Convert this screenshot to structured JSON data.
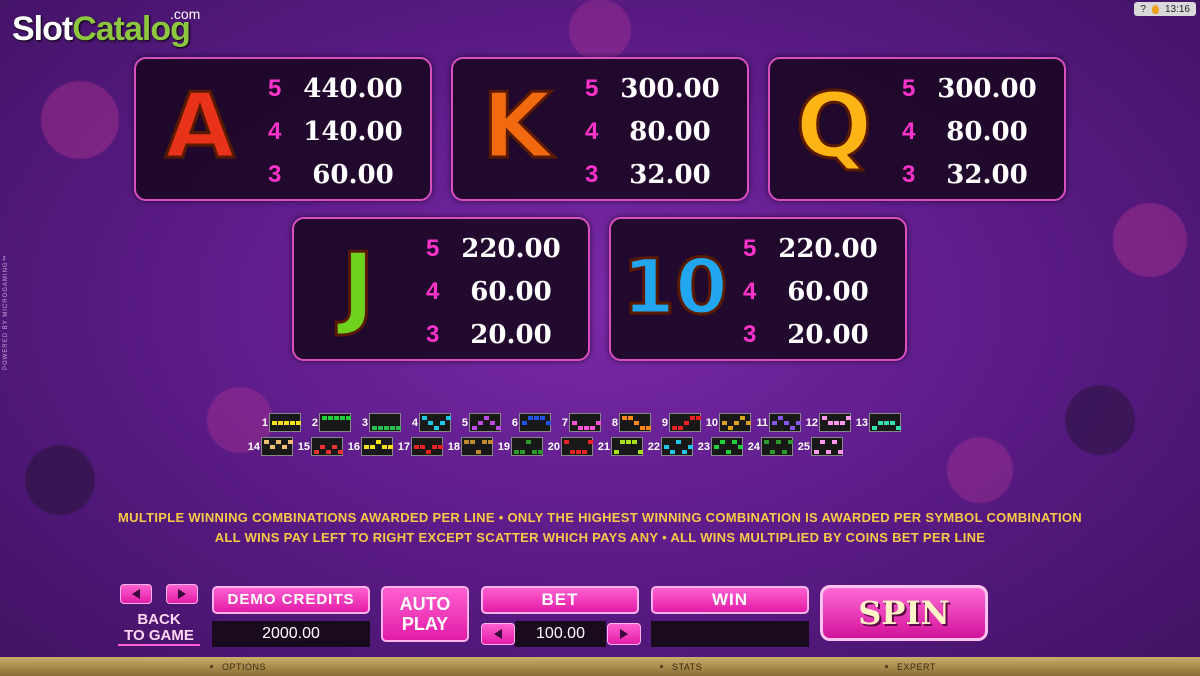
{
  "brand": {
    "slot": "Slot",
    "catalog": "Catalog",
    "com": ".com"
  },
  "system": {
    "help": "?",
    "time": "13:16"
  },
  "powered_by": "POWERED BY MICROGAMING™",
  "paytable": [
    {
      "symbol": "A",
      "color": "#e8321a",
      "pays": [
        {
          "count": "5",
          "value": "440.00"
        },
        {
          "count": "4",
          "value": "140.00"
        },
        {
          "count": "3",
          "value": "60.00"
        }
      ]
    },
    {
      "symbol": "K",
      "color": "#f26a10",
      "pays": [
        {
          "count": "5",
          "value": "300.00"
        },
        {
          "count": "4",
          "value": "80.00"
        },
        {
          "count": "3",
          "value": "32.00"
        }
      ]
    },
    {
      "symbol": "Q",
      "color": "#fdb515",
      "pays": [
        {
          "count": "5",
          "value": "300.00"
        },
        {
          "count": "4",
          "value": "80.00"
        },
        {
          "count": "3",
          "value": "32.00"
        }
      ]
    },
    {
      "symbol": "J",
      "color": "#6fd21e",
      "pays": [
        {
          "count": "5",
          "value": "220.00"
        },
        {
          "count": "4",
          "value": "60.00"
        },
        {
          "count": "3",
          "value": "20.00"
        }
      ]
    },
    {
      "symbol": "10",
      "color": "#22a6ef",
      "pays": [
        {
          "count": "5",
          "value": "220.00"
        },
        {
          "count": "4",
          "value": "60.00"
        },
        {
          "count": "3",
          "value": "20.00"
        }
      ]
    }
  ],
  "paylines": [
    {
      "n": "1",
      "color": "#f5e11a",
      "rows": [
        1,
        1,
        1,
        1,
        1
      ]
    },
    {
      "n": "2",
      "color": "#1fd13a",
      "rows": [
        0,
        0,
        0,
        0,
        0
      ]
    },
    {
      "n": "3",
      "color": "#29c04a",
      "rows": [
        2,
        2,
        2,
        2,
        2
      ]
    },
    {
      "n": "4",
      "color": "#1fc7e8",
      "rows": [
        0,
        1,
        2,
        1,
        0
      ]
    },
    {
      "n": "5",
      "color": "#c04ae8",
      "rows": [
        2,
        1,
        0,
        1,
        2
      ]
    },
    {
      "n": "6",
      "color": "#2255ee",
      "rows": [
        1,
        0,
        0,
        0,
        1
      ]
    },
    {
      "n": "7",
      "color": "#ff55dd",
      "rows": [
        1,
        2,
        2,
        2,
        1
      ]
    },
    {
      "n": "8",
      "color": "#ff8a1a",
      "rows": [
        0,
        0,
        1,
        2,
        2
      ]
    },
    {
      "n": "9",
      "color": "#ee2222",
      "rows": [
        2,
        2,
        1,
        0,
        0
      ]
    },
    {
      "n": "10",
      "color": "#d9a41a",
      "rows": [
        1,
        2,
        1,
        0,
        1
      ]
    },
    {
      "n": "11",
      "color": "#8a55ee",
      "rows": [
        1,
        0,
        1,
        2,
        1
      ]
    },
    {
      "n": "12",
      "color": "#ff99ee",
      "rows": [
        0,
        1,
        1,
        1,
        0
      ]
    },
    {
      "n": "13",
      "color": "#33e0b0",
      "rows": [
        2,
        1,
        1,
        1,
        2
      ]
    },
    {
      "n": "14",
      "color": "#f0c070",
      "rows": [
        0,
        1,
        0,
        1,
        0
      ]
    },
    {
      "n": "15",
      "color": "#ee3333",
      "rows": [
        2,
        1,
        2,
        1,
        2
      ]
    },
    {
      "n": "16",
      "color": "#f5e11a",
      "rows": [
        1,
        1,
        0,
        1,
        1
      ]
    },
    {
      "n": "17",
      "color": "#ee2222",
      "rows": [
        1,
        1,
        2,
        1,
        1
      ]
    },
    {
      "n": "18",
      "color": "#c08a30",
      "rows": [
        0,
        0,
        2,
        0,
        0
      ]
    },
    {
      "n": "19",
      "color": "#2a9a2a",
      "rows": [
        2,
        2,
        0,
        2,
        2
      ]
    },
    {
      "n": "20",
      "color": "#ee2222",
      "rows": [
        0,
        2,
        2,
        2,
        0
      ]
    },
    {
      "n": "21",
      "color": "#a8e01a",
      "rows": [
        2,
        0,
        0,
        0,
        2
      ]
    },
    {
      "n": "22",
      "color": "#1fc7e8",
      "rows": [
        1,
        2,
        0,
        2,
        1
      ]
    },
    {
      "n": "23",
      "color": "#1fd13a",
      "rows": [
        1,
        0,
        2,
        0,
        1
      ]
    },
    {
      "n": "24",
      "color": "#2a9a2a",
      "rows": [
        0,
        2,
        0,
        2,
        0
      ]
    },
    {
      "n": "25",
      "color": "#ff99ee",
      "rows": [
        2,
        0,
        2,
        0,
        2
      ]
    }
  ],
  "rules": {
    "line1": "MULTIPLE WINNING COMBINATIONS AWARDED PER LINE  •  ONLY THE HIGHEST WINNING COMBINATION IS AWARDED PER SYMBOL COMBINATION",
    "line2": "ALL WINS PAY LEFT TO RIGHT EXCEPT SCATTER WHICH PAYS ANY  •  ALL WINS MULTIPLIED BY COINS BET PER LINE"
  },
  "controls": {
    "back_line1": "BACK",
    "back_line2": "TO GAME",
    "demo_credits_label": "DEMO CREDITS",
    "demo_credits_value": "2000.00",
    "autoplay_line1": "AUTO",
    "autoplay_line2": "PLAY",
    "bet_label": "BET",
    "bet_value": "100.00",
    "win_label": "WIN",
    "win_value": "",
    "spin_label": "SPIN"
  },
  "bottom_bar": {
    "options": "OPTIONS",
    "stats": "STATS",
    "expert": "EXPERT"
  }
}
